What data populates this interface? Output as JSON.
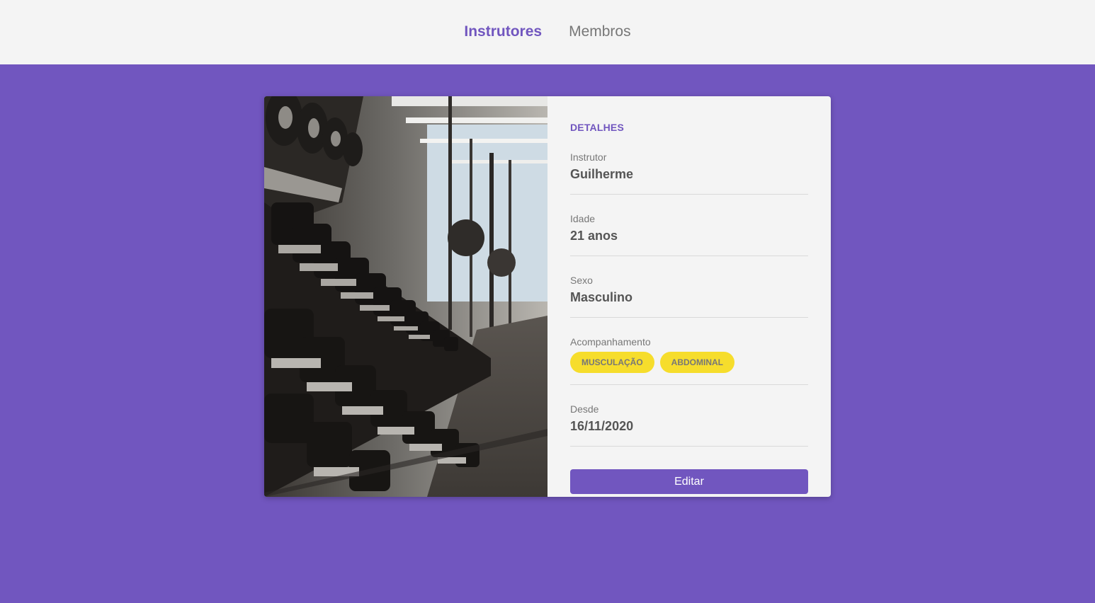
{
  "nav": {
    "items": [
      {
        "label": "Instrutores",
        "active": true
      },
      {
        "label": "Membros",
        "active": false
      }
    ]
  },
  "card": {
    "image_alt": "gym-dumbbell-rack-photo",
    "title": "DETALHES",
    "fields": {
      "instructor": {
        "label": "Instrutor",
        "value": "Guilherme"
      },
      "age": {
        "label": "Idade",
        "value": "21 anos"
      },
      "gender": {
        "label": "Sexo",
        "value": "Masculino"
      },
      "services": {
        "label": "Acompanhamento",
        "tags": [
          "MUSCULAÇÃO",
          "ABDOMINAL"
        ]
      },
      "since": {
        "label": "Desde",
        "value": "16/11/2020"
      }
    },
    "edit_label": "Editar"
  },
  "colors": {
    "primary": "#7156bf",
    "background_header": "#f4f4f4",
    "tag": "#f6dd2c"
  }
}
